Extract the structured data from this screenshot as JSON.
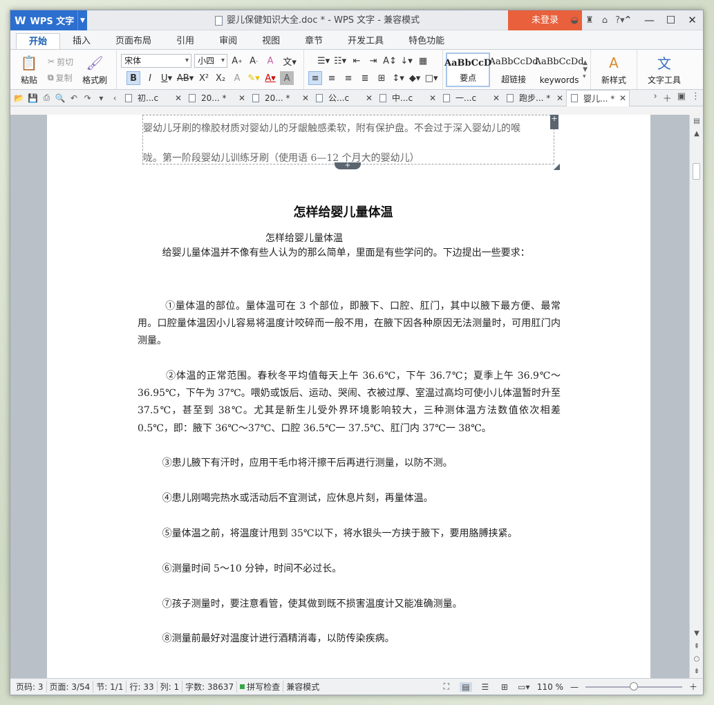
{
  "app": {
    "name": "WPS 文字",
    "title": "婴儿保健知识大全.doc * - WPS 文字 - 兼容模式",
    "login": "未登录"
  },
  "ribbon_tabs": [
    "开始",
    "插入",
    "页面布局",
    "引用",
    "审阅",
    "视图",
    "章节",
    "开发工具",
    "特色功能"
  ],
  "toolbar": {
    "paste": "粘贴",
    "cut": "剪切",
    "copy": "复制",
    "format_painter": "格式刷",
    "font_name": "宋体",
    "font_size": "小四",
    "styles": [
      {
        "sample": "AaBbCcD",
        "name": "要点"
      },
      {
        "sample": "AaBbCcDd",
        "name": "超链接"
      },
      {
        "sample": "AaBbCcDd",
        "name": "keywords"
      }
    ],
    "new_style": "新样式",
    "text_tools": "文字工具"
  },
  "doc_tabs": [
    "初...c",
    "20... *",
    "20... *",
    "公...c",
    "中...c",
    "一...c",
    "跑步... *",
    "婴儿... *"
  ],
  "document": {
    "textbox_line1": "婴幼儿牙刷的橡胶材质对婴幼儿的牙龈触感柔软，附有保护盘。不会过于深入婴幼儿的喉",
    "textbox_line2": "咙。第一阶段婴幼儿训练牙刷（使用语 6—12 个月大的婴幼儿）",
    "heading": "怎样给婴儿量体温",
    "subheading": "怎样给婴儿量体温",
    "paragraphs": [
      "        给婴儿量体温并不像有些人认为的那么简单，里面是有些学问的。下边提出一些要求：",
      "        ①量体温的部位。量体温可在 3 个部位，即腋下、口腔、肛门，其中以腋下最方便、最常用。口腔量体温因小儿容易将温度计咬碎而一般不用，在腋下因各种原因无法测量时，可用肛门内测量。",
      "        ②体温的正常范围。春秋冬平均值每天上午 36.6℃，下午 36.7℃；夏季上午 36.9℃～36.95℃，下午为 37℃。喂奶或饭后、运动、哭闹、衣被过厚、室温过高均可使小儿体温暂时升至 37.5℃，甚至到 38℃。尤其是新生儿受外界环境影响较大，三种测体温方法数值依次相差 0.5℃，即：腋下 36℃～37℃、口腔 36.5℃一 37.5℃、肛门内 37℃一 38℃。",
      "        ③患儿腋下有汗时，应用干毛巾将汗擦干后再进行测量，以防不测。",
      "        ④患儿刚喝完热水或活动后不宜测试，应休息片刻，再量体温。",
      "        ⑤量体温之前，将温度计甩到 35℃以下，将水银头一方挟于腋下，要用胳膊挟紧。",
      "        ⑥测量时间 5～10 分钟，时间不必过长。",
      "        ⑦孩子测量时，要注意看管，使其做到既不损害温度计又能准确测量。",
      "        ⑧测量前最好对温度计进行酒精消毒，以防传染疾病。"
    ]
  },
  "status": {
    "page_num": "页码: 3",
    "page": "页面: 3/54",
    "section": "节: 1/1",
    "row": "行: 33",
    "col": "列: 1",
    "words": "字数: 38637",
    "spell": "拼写检查",
    "compat": "兼容模式",
    "zoom": "110 %"
  },
  "colors": {
    "accent": "#2c6fcf",
    "login": "#e8603c"
  }
}
